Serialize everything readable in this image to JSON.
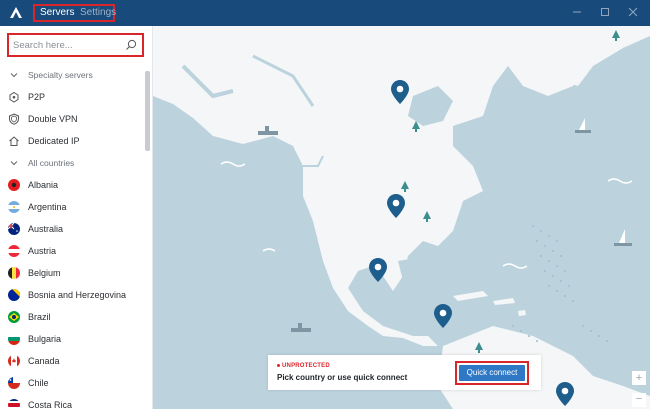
{
  "header": {
    "tabs": [
      "Servers",
      "Settings"
    ],
    "active_tab": "Servers",
    "window_controls": [
      "minimize-icon",
      "maximize-icon",
      "close-icon"
    ]
  },
  "search": {
    "placeholder": "Search here..."
  },
  "sidebar": {
    "items": [
      {
        "label": "Specialty servers",
        "icon": "chevron-down-icon",
        "type": "section"
      },
      {
        "label": "P2P",
        "icon": "p2p-icon",
        "type": "item"
      },
      {
        "label": "Double VPN",
        "icon": "double-vpn-icon",
        "type": "item"
      },
      {
        "label": "Dedicated IP",
        "icon": "home-icon",
        "type": "item"
      },
      {
        "label": "All countries",
        "icon": "chevron-down-icon",
        "type": "section"
      },
      {
        "label": "Albania",
        "icon": "flag-albania",
        "type": "country"
      },
      {
        "label": "Argentina",
        "icon": "flag-argentina",
        "type": "country"
      },
      {
        "label": "Australia",
        "icon": "flag-australia",
        "type": "country"
      },
      {
        "label": "Austria",
        "icon": "flag-austria",
        "type": "country"
      },
      {
        "label": "Belgium",
        "icon": "flag-belgium",
        "type": "country"
      },
      {
        "label": "Bosnia and Herzegovina",
        "icon": "flag-bosnia",
        "type": "country"
      },
      {
        "label": "Brazil",
        "icon": "flag-brazil",
        "type": "country"
      },
      {
        "label": "Bulgaria",
        "icon": "flag-bulgaria",
        "type": "country"
      },
      {
        "label": "Canada",
        "icon": "flag-canada",
        "type": "country"
      },
      {
        "label": "Chile",
        "icon": "flag-chile",
        "type": "country"
      },
      {
        "label": "Costa Rica",
        "icon": "flag-costa-rica",
        "type": "country"
      }
    ]
  },
  "status": {
    "label": "UNPROTECTED",
    "message": "Pick country or use quick connect",
    "color": "#D9262B"
  },
  "quick_connect": {
    "label": "Quick connect",
    "color": "#2E78C6"
  },
  "zoom": {
    "plus": "+",
    "minus": "−"
  },
  "colors": {
    "titlebar": "#184B7B",
    "ocean": "#BCD3DE",
    "land": "#F4F6F7",
    "pin": "#1E5E8C",
    "highlight": "#D9262B"
  }
}
